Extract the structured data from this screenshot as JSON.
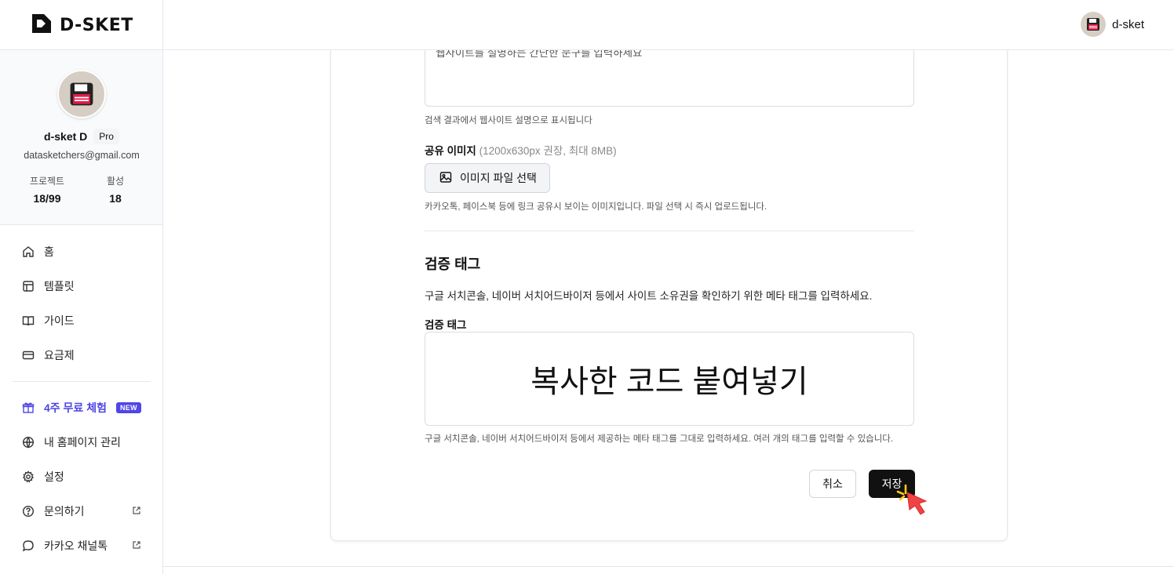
{
  "app": {
    "logo_text": "D-SKET"
  },
  "header": {
    "user_name": "d-sket"
  },
  "profile": {
    "name": "d-sket D",
    "plan": "Pro",
    "email": "datasketchers@gmail.com",
    "stats": [
      {
        "label": "프로젝트",
        "value": "18/99"
      },
      {
        "label": "활성",
        "value": "18"
      }
    ]
  },
  "nav": {
    "items": [
      {
        "label": "홈",
        "icon": "home-icon"
      },
      {
        "label": "템플릿",
        "icon": "template-icon"
      },
      {
        "label": "가이드",
        "icon": "book-icon"
      },
      {
        "label": "요금제",
        "icon": "card-icon"
      }
    ],
    "promo": {
      "label": "4주 무료 체험",
      "badge": "NEW",
      "icon": "gift-icon"
    },
    "secondary": [
      {
        "label": "내 홈페이지 관리",
        "icon": "globe-icon"
      },
      {
        "label": "설정",
        "icon": "gear-icon"
      },
      {
        "label": "문의하기",
        "icon": "help-icon",
        "external": true
      },
      {
        "label": "카카오 채널톡",
        "icon": "chat-icon",
        "external": true
      }
    ]
  },
  "form": {
    "description": {
      "placeholder": "웹사이트를 설명하는 간단한 문구를 입력하세요",
      "help": "검색 결과에서 웹사이트 설명으로 표시됩니다"
    },
    "share_image": {
      "label": "공유 이미지",
      "label_sub": "(1200x630px 권장, 최대 8MB)",
      "button": "이미지 파일 선택",
      "help": "카카오톡, 페이스북 등에 링크 공유시 보이는 이미지입니다. 파일 선택 시 즉시 업로드됩니다."
    },
    "verification": {
      "title": "검증 태그",
      "description": "구글 서치콘솔, 네이버 서치어드바이저 등에서 사이트 소유권을 확인하기 위한 메타 태그를 입력하세요.",
      "label": "검증 태그",
      "code_value": "복사한 코드 붙여넣기",
      "help": "구글 서치콘솔, 네이버 서치어드바이저 등에서 제공하는 메타 태그를 그대로 입력하세요. 여러 개의 태그를 입력할 수 있습니다."
    },
    "actions": {
      "cancel": "취소",
      "save": "저장"
    }
  },
  "colors": {
    "accent": "#4f46e5",
    "primary_button": "#111111",
    "cursor": "#ef4444",
    "click_flash": "#facc15"
  }
}
